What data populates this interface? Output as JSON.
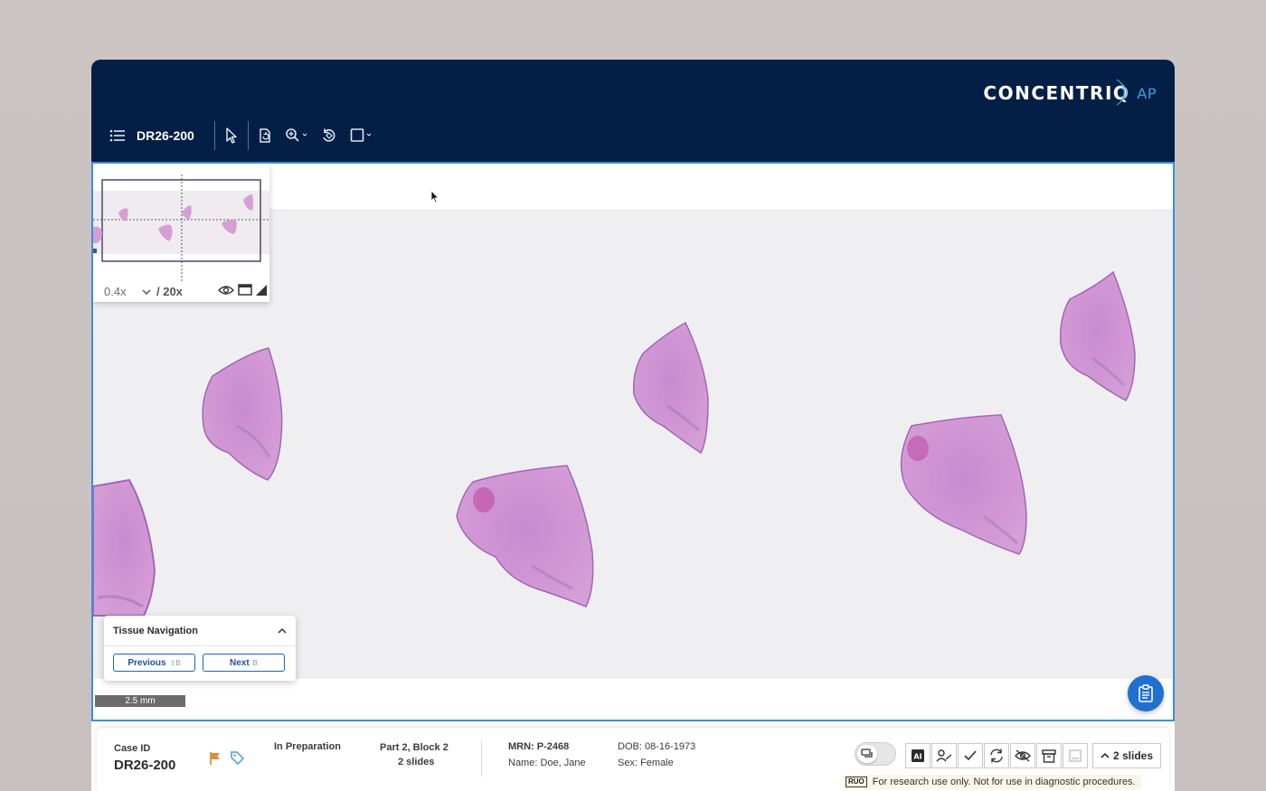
{
  "app": {
    "logo_word": "CONCENTRIQ",
    "logo_suffix": "AP",
    "accent_color": "#1f70cf",
    "header_color": "#031f45"
  },
  "toolbar": {
    "case_title": "DR26-200",
    "icons": [
      "list-icon",
      "pointer-icon",
      "slide-rotate-icon",
      "zoom-icon",
      "rotate-icon",
      "annotation-rectangle-icon"
    ]
  },
  "overview": {
    "zoom_current": "0.4x",
    "zoom_max": "/ 20x",
    "icons": [
      "eye-icon",
      "window-icon",
      "contrast-icon"
    ]
  },
  "tissue_navigation": {
    "title": "Tissue Navigation",
    "previous_label": "Previous",
    "previous_shortcut": "⇧B",
    "next_label": "Next",
    "next_shortcut": "B"
  },
  "scale_bar": "2.5 mm",
  "infobar": {
    "case_id_label": "Case ID",
    "case_id": "DR26-200",
    "status": "In Preparation",
    "part_block": "Part 2, Block 2",
    "slide_count": "2 slides",
    "mrn": "MRN: P-2468",
    "name": "Name: Doe, Jane",
    "dob": "DOB: 08-16-1973",
    "sex": "Sex: Female",
    "slides_button": "2 slides",
    "ruo_tag": "RUO",
    "ruo_text": "For research use only. Not for use in diagnostic procedures.",
    "flag_color": "#d9923b",
    "tag_color": "#4a9ad8"
  }
}
